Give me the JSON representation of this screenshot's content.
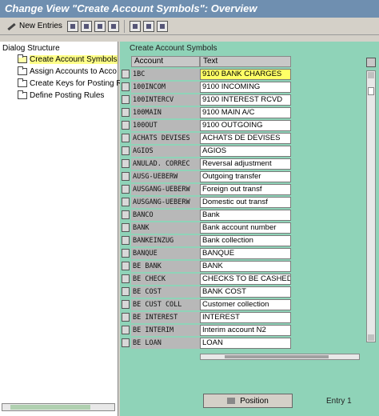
{
  "window": {
    "title": "Change View \"Create Account Symbols\": Overview"
  },
  "toolbar": {
    "new_entries_label": "New Entries"
  },
  "structure": {
    "title": "Dialog Structure",
    "items": [
      {
        "label": "Create Account Symbols",
        "selected": true
      },
      {
        "label": "Assign Accounts to Acco",
        "selected": false
      },
      {
        "label": "Create Keys for Posting R",
        "selected": false
      },
      {
        "label": "Define Posting Rules",
        "selected": false
      }
    ]
  },
  "group": {
    "label": "Create Account Symbols"
  },
  "table": {
    "columns": [
      "Account",
      "Text"
    ],
    "rows": [
      {
        "account": "1BC",
        "text": "9100 BANK CHARGES"
      },
      {
        "account": "100INCOM",
        "text": "9100 INCOMING"
      },
      {
        "account": "100INTERCV",
        "text": "9100 INTEREST RCVD"
      },
      {
        "account": "100MAIN",
        "text": "9100 MAIN A/C"
      },
      {
        "account": "100OUT",
        "text": "9100 OUTGOING"
      },
      {
        "account": "ACHATS DEVISES",
        "text": "ACHATS DE DEVISES"
      },
      {
        "account": "AGIOS",
        "text": "AGIOS"
      },
      {
        "account": "ANULAD. CORREC",
        "text": "Reversal adjustment"
      },
      {
        "account": "AUSG-UEBERW",
        "text": "Outgoing transfer"
      },
      {
        "account": "AUSGANG-UEBERW",
        "text": "Foreign out transf"
      },
      {
        "account": "AUSGANG-UEBERW",
        "text": "Domestic out transf"
      },
      {
        "account": "BANCO",
        "text": "Bank"
      },
      {
        "account": "BANK",
        "text": "Bank account number"
      },
      {
        "account": "BANKEINZUG",
        "text": "Bank collection"
      },
      {
        "account": "BANQUE",
        "text": "BANQUE"
      },
      {
        "account": "BE BANK",
        "text": "BANK"
      },
      {
        "account": "BE CHECK",
        "text": "CHECKS TO BE CASHED"
      },
      {
        "account": "BE COST",
        "text": "BANK COST"
      },
      {
        "account": "BE CUST COLL",
        "text": "Customer collection"
      },
      {
        "account": "BE INTEREST",
        "text": "INTEREST"
      },
      {
        "account": "BE INTERIM",
        "text": "Interim account N2"
      },
      {
        "account": "BE LOAN",
        "text": "LOAN"
      }
    ]
  },
  "footer": {
    "position_label": "Position",
    "entry_info": "Entry 1"
  }
}
